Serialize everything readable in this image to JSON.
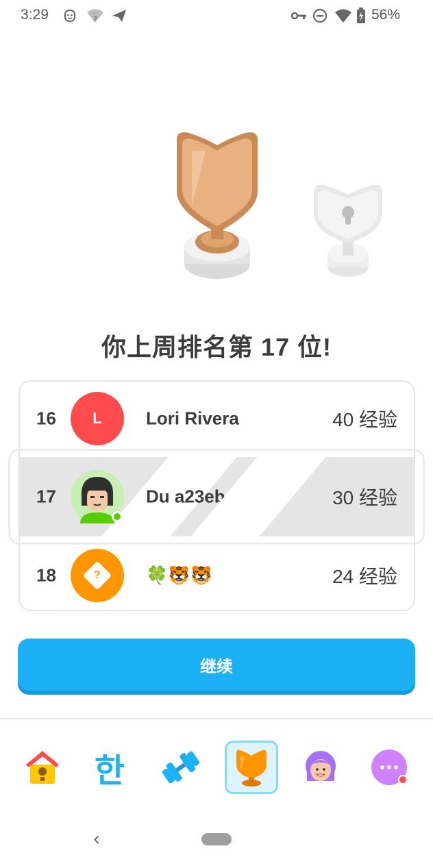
{
  "status_bar": {
    "time": "3:29",
    "battery": "56%",
    "icons": [
      "face-icon",
      "wifi-question-icon",
      "send-icon",
      "vpn-key-icon",
      "do-not-disturb-icon",
      "wifi-icon",
      "battery-charging-icon"
    ]
  },
  "trophies": {
    "current_league": "bronze-trophy-icon",
    "next_league": "locked-silver-trophy-icon"
  },
  "headline": "你上周排名第 17 位!",
  "leaderboard": {
    "rows": [
      {
        "rank": "16",
        "avatar_letter": "L",
        "avatar_color": "#ff4b4b",
        "name": "Lori Rivera",
        "xp": "40 经验"
      },
      {
        "rank": "17",
        "avatar_letter": "",
        "avatar_color": "#c8f0b4",
        "name": "Du        a23eb",
        "xp": "30 经验",
        "highlighted": true,
        "online": true
      },
      {
        "rank": "18",
        "avatar_letter": "?",
        "avatar_color": "#ff9600",
        "name": "🍀🐯🐯",
        "xp": "24 经验"
      }
    ]
  },
  "continue_button": "继续",
  "bottom_nav": {
    "items": [
      {
        "name": "home-icon"
      },
      {
        "name": "korean-course-icon",
        "glyph": "한"
      },
      {
        "name": "dumbbell-icon"
      },
      {
        "name": "leaderboard-trophy-icon",
        "active": true
      },
      {
        "name": "profile-icon"
      },
      {
        "name": "more-icon"
      }
    ]
  },
  "colors": {
    "accent_blue": "#1cb0f6",
    "bronze": "#d99f6e",
    "highlight_row": "#e5e5e5"
  }
}
